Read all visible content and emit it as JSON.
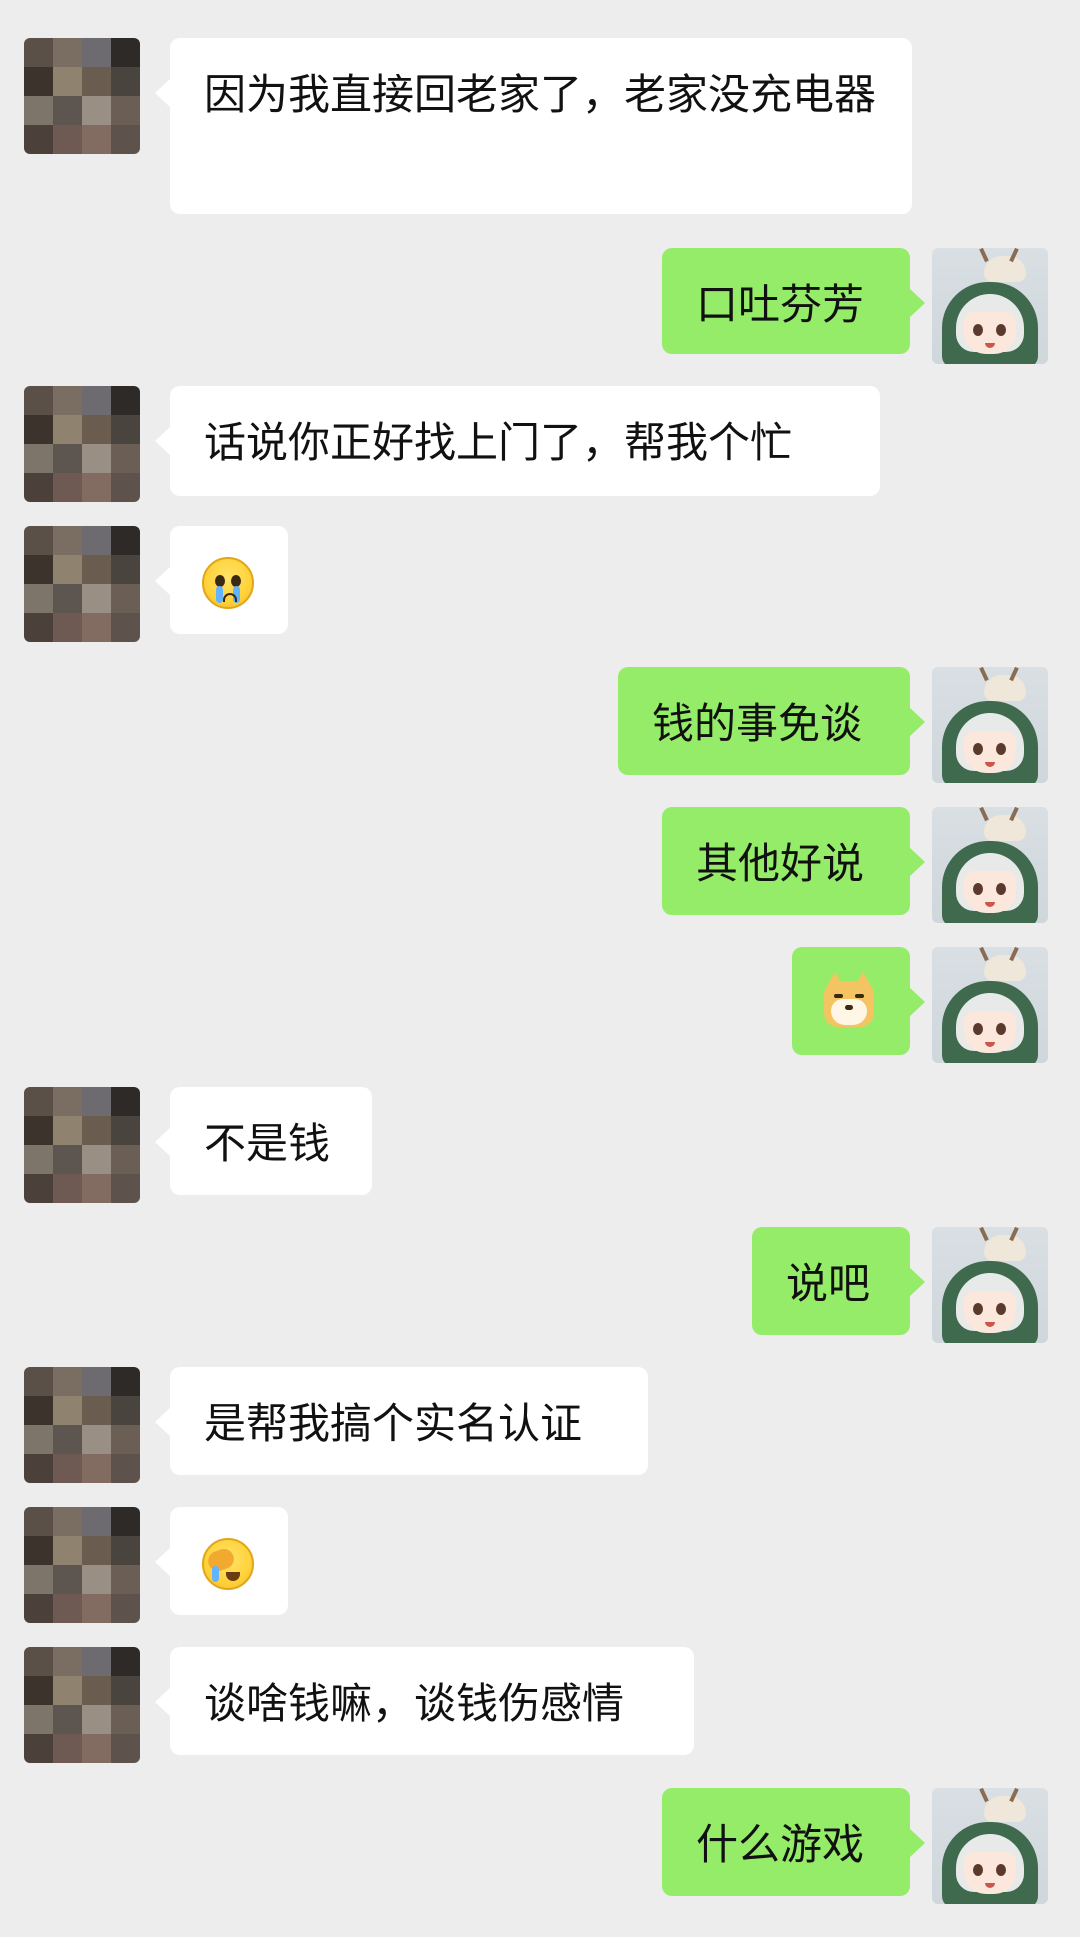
{
  "colors": {
    "background": "#ededed",
    "incoming_bubble": "#ffffff",
    "outgoing_bubble": "#95ec69"
  },
  "messages": [
    {
      "side": "left",
      "type": "text",
      "text": "因为我直接回老家了，老家没充电器"
    },
    {
      "side": "right",
      "type": "text",
      "text": "口吐芬芳"
    },
    {
      "side": "left",
      "type": "text",
      "text": "话说你正好找上门了，帮我个忙"
    },
    {
      "side": "left",
      "type": "emoji",
      "icon": "crying-face-emoji"
    },
    {
      "side": "right",
      "type": "text",
      "text": "钱的事免谈"
    },
    {
      "side": "right",
      "type": "text",
      "text": "其他好说"
    },
    {
      "side": "right",
      "type": "emoji",
      "icon": "doge-emoji"
    },
    {
      "side": "left",
      "type": "text",
      "text": "不是钱"
    },
    {
      "side": "right",
      "type": "text",
      "text": "说吧"
    },
    {
      "side": "left",
      "type": "text",
      "text": "是帮我搞个实名认证"
    },
    {
      "side": "left",
      "type": "emoji",
      "icon": "facepalm-emoji"
    },
    {
      "side": "left",
      "type": "text",
      "text": "谈啥钱嘛，谈钱伤感情"
    },
    {
      "side": "right",
      "type": "text",
      "text": "什么游戏"
    }
  ]
}
